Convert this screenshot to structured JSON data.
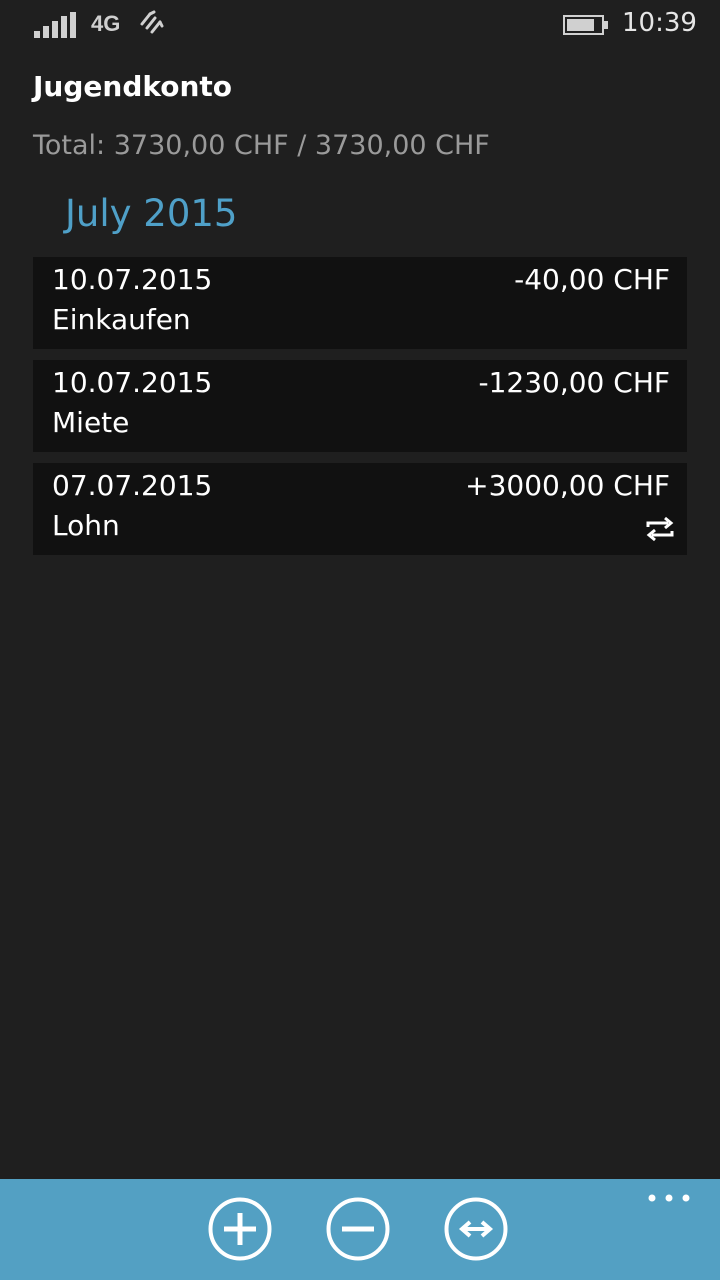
{
  "status_bar": {
    "network": "4G",
    "time": "10:39",
    "icons": [
      "signal-strength-icon",
      "data-sync-icon",
      "battery-icon"
    ]
  },
  "header": {
    "account_name": "Jugendkonto",
    "total": "Total: 3730,00 CHF / 3730,00 CHF"
  },
  "month": "July 2015",
  "transactions": [
    {
      "date": "10.07.2015",
      "description": "Einkaufen",
      "amount": "-40,00 CHF",
      "recurring": false
    },
    {
      "date": "10.07.2015",
      "description": "Miete",
      "amount": "-1230,00 CHF",
      "recurring": false
    },
    {
      "date": "07.07.2015",
      "description": "Lohn",
      "amount": "+3000,00 CHF",
      "recurring": true
    }
  ],
  "app_bar": {
    "buttons": [
      "add-icon",
      "subtract-icon",
      "transfer-icon"
    ],
    "more": "more-icon"
  },
  "colors": {
    "background": "#1f1f1f",
    "item_background": "#111111",
    "accent": "#53a0c3",
    "month_header": "#4fa0c8",
    "secondary_text": "#9a9a9a"
  }
}
